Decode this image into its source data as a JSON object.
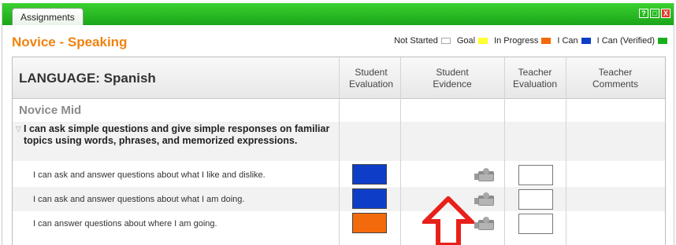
{
  "window": {
    "tab_label": "Assignments",
    "controls": [
      "?",
      "□",
      "X"
    ]
  },
  "page_title": "Novice - Speaking",
  "legend": [
    {
      "label": "Not Started",
      "color": "#ffffff"
    },
    {
      "label": "Goal",
      "color": "#ffff33"
    },
    {
      "label": "In Progress",
      "color": "#f26a0c"
    },
    {
      "label": "I Can",
      "color": "#0e3ec8"
    },
    {
      "label": "I Can (Verified)",
      "color": "#19b01c"
    }
  ],
  "table": {
    "language_title": "LANGUAGE: Spanish",
    "columns": [
      "Student\nEvaluation",
      "Student\nEvidence",
      "Teacher\nEvaluation",
      "Teacher\nComments"
    ],
    "section": "Novice Mid",
    "goal": "I can ask simple questions and give simple responses on familiar topics using words, phrases, and memorized expressions.",
    "rows": [
      {
        "label": "I can ask and answer questions about what I like and dislike.",
        "student_eval_color": "#0e3ec8",
        "evidence_icon": "camera-icon"
      },
      {
        "label": "I can ask and answer questions about what I am doing.",
        "student_eval_color": "#0e3ec8",
        "evidence_icon": "camera-icon"
      },
      {
        "label": "I can answer questions about where I am going.",
        "student_eval_color": "#f26a0c",
        "evidence_icon": "camera-icon"
      }
    ]
  },
  "annotation": {
    "arrow_color": "#e8201a"
  }
}
